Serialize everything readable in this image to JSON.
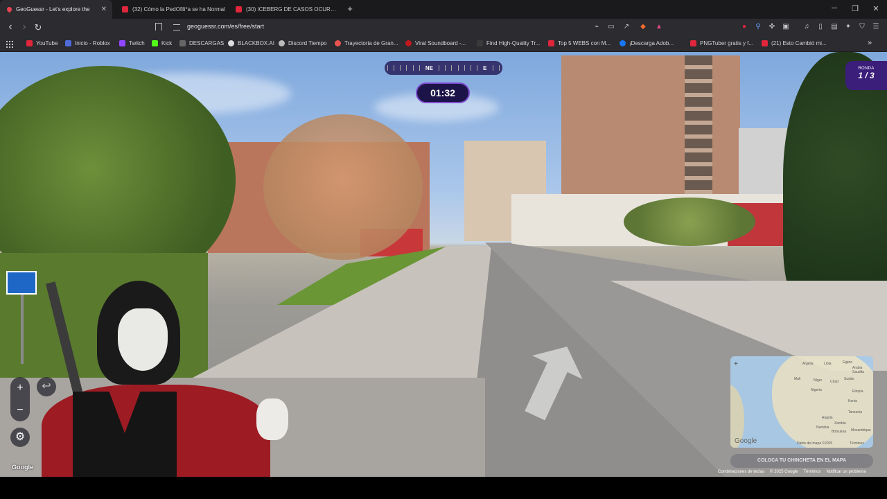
{
  "tabs": [
    {
      "title": "GeoGuessr - Let's explore the",
      "active": true,
      "icon": "geoguessr-pin-icon"
    },
    {
      "title": "(32) Cómo la PedOfili*a se ha Normal",
      "active": false,
      "icon": "youtube-icon"
    },
    {
      "title": "(30) ICEBERG DE CASOS OCURRIDOS",
      "active": false,
      "icon": "youtube-icon"
    }
  ],
  "tab_close": "✕",
  "new_tab": "+",
  "window": {
    "minimize": "─",
    "restore": "❐",
    "close": "✕"
  },
  "nav": {
    "back": "‹",
    "forward": "›",
    "reload": "↻"
  },
  "address": {
    "url": "geoguessr.com/es/free/start"
  },
  "bookmarks": [
    {
      "label": "YouTube",
      "color": "#e0263b"
    },
    {
      "label": "Inicio - Roblox",
      "color": "#4f6bd8"
    },
    {
      "label": "Twitch",
      "color": "#9146ff"
    },
    {
      "label": "Kick",
      "color": "#53fc18"
    },
    {
      "label": "DESCARGAS",
      "color": "#666666"
    },
    {
      "label": "BLACKBOX.AI",
      "color": "#dddddd"
    },
    {
      "label": "Discord Tiempo",
      "color": "#bbbbbb"
    },
    {
      "label": "Trayectoria de Gran...",
      "color": "#e8554e"
    },
    {
      "label": "Viral Soundboard -...",
      "color": "#c0181e"
    },
    {
      "label": "Find High-Quality Tr...",
      "color": "#3a3a3a"
    },
    {
      "label": "Top 5 WEBS con M...",
      "color": "#e0263b"
    },
    {
      "label": "¡Descarga Adob...",
      "color": "#1877f2"
    },
    {
      "label": "PNGTuber gratis y f...",
      "color": "#e0263b"
    },
    {
      "label": "(21) Esto Cambió mi...",
      "color": "#e0263b"
    }
  ],
  "bookmarks_more": "»",
  "game": {
    "compass_labels": [
      "NE",
      "E"
    ],
    "timer": "01:32",
    "round_label": "RONDA",
    "round_value": "1 / 3",
    "zoom_in": "+",
    "zoom_out": "−",
    "undo": "↩",
    "settings_icon": "⚙",
    "place_pin_label": "COLOCA TU CHINCHETA EN EL MAPA",
    "google_watermark": "Google"
  },
  "minimap": {
    "zoom_in": "+",
    "google": "Google",
    "data": "Datos del mapa ©2025",
    "terms": "Términos",
    "labels": [
      "Argelia",
      "Libia",
      "Egipto",
      "Arabia Saudita",
      "Mali",
      "Níger",
      "Chad",
      "Sudán",
      "Nigeria",
      "Etiopía",
      "Kenia",
      "Tanzania",
      "Angola",
      "Zambia",
      "Namibia",
      "Botsuana",
      "Mozambique"
    ]
  },
  "footer": [
    "Combinaciones de teclas",
    "© 2025 Google",
    "Términos",
    "Notificar un problema"
  ],
  "colors": {
    "accent": "#7d4cd0",
    "round_bg": "#3b1d7a",
    "timer_bg": "#1c1448"
  }
}
